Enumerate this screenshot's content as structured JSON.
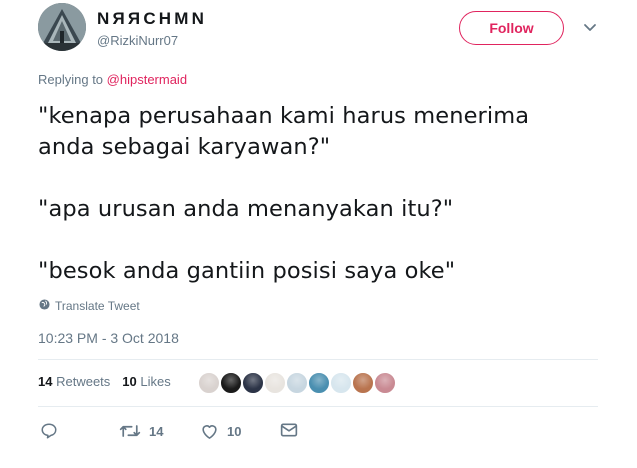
{
  "author": {
    "display_name": "NЯЯCHMN",
    "screen_name": "@RizkiNurr07"
  },
  "follow_label": "Follow",
  "replying": {
    "prefix": "Replying to ",
    "handle": "@hipstermaid"
  },
  "tweet": {
    "lines": [
      "\"kenapa perusahaan kami harus menerima",
      "anda sebagai karyawan?\"",
      "\"apa urusan anda menanyakan itu?\"",
      "\"besok anda gantiin posisi saya oke\""
    ]
  },
  "translate_label": "Translate Tweet",
  "timestamp": "10:23 PM - 3 Oct 2018",
  "stats": {
    "retweets_count": "14",
    "retweets_label": "Retweets",
    "likes_count": "10",
    "likes_label": "Likes"
  },
  "actions": {
    "reply_count": "",
    "retweet_count": "14",
    "like_count": "10"
  },
  "liker_colors": [
    "#d9d2cf",
    "#1a1a1a",
    "#2c3447",
    "#e8e4df",
    "#c7d6e0",
    "#4a8fb0",
    "#d7e6ee",
    "#b9744f",
    "#c98a93"
  ],
  "colors": {
    "accent": "#e0245e",
    "muted": "#657786",
    "text": "#14171a"
  }
}
